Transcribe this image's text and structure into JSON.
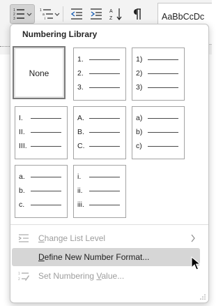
{
  "ribbon": {
    "numbering_active": true,
    "style_sample": "AaBbCcDc"
  },
  "menu": {
    "title": "Numbering Library",
    "tiles": [
      {
        "name": "none",
        "label": "None",
        "rows": [],
        "selected": true
      },
      {
        "name": "arabic-period",
        "label": "",
        "rows": [
          "1.",
          "2.",
          "3."
        ],
        "selected": false
      },
      {
        "name": "arabic-paren",
        "label": "",
        "rows": [
          "1)",
          "2)",
          "3)"
        ],
        "selected": false
      },
      {
        "name": "roman-upper",
        "label": "",
        "rows": [
          "I.",
          "II.",
          "III."
        ],
        "selected": false
      },
      {
        "name": "alpha-upper",
        "label": "",
        "rows": [
          "A.",
          "B.",
          "C."
        ],
        "selected": false
      },
      {
        "name": "alpha-lower-paren",
        "label": "",
        "rows": [
          "a)",
          "b)",
          "c)"
        ],
        "selected": false
      },
      {
        "name": "alpha-lower-period",
        "label": "",
        "rows": [
          "a.",
          "b.",
          "c."
        ],
        "selected": false
      },
      {
        "name": "roman-lower",
        "label": "",
        "rows": [
          "i.",
          "ii.",
          "iii."
        ],
        "selected": false
      }
    ],
    "items": [
      {
        "name": "change-list-level",
        "label_key": "C",
        "label_rest": "hange List Level",
        "disabled": true,
        "submenu": true,
        "icon": "list-level-icon"
      },
      {
        "name": "define-new-number-format",
        "label_key": "D",
        "label_rest": "efine New Number Format...",
        "disabled": false,
        "hover": true,
        "icon": ""
      },
      {
        "name": "set-numbering-value",
        "label_key": "V",
        "label_pre": "Set Numbering ",
        "label_rest": "alue...",
        "disabled": true,
        "icon": "numbering-value-icon"
      }
    ]
  }
}
